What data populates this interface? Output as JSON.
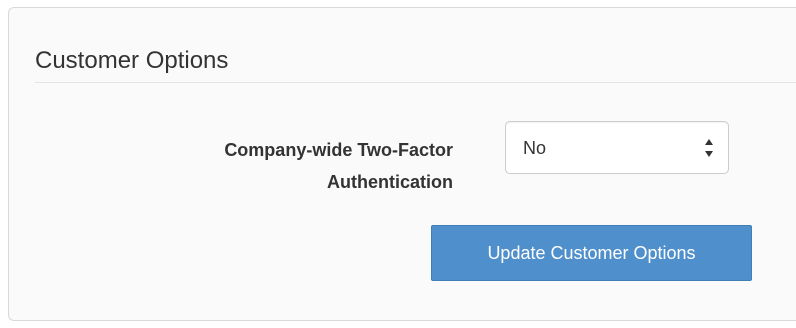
{
  "panel": {
    "title": "Customer Options"
  },
  "form": {
    "two_factor": {
      "label": "Company-wide Two-Factor Authentication",
      "selected_value": "No"
    },
    "submit_label": "Update Customer Options"
  },
  "icons": {
    "select_arrows": "sort-arrows-icon"
  },
  "colors": {
    "button_bg": "#4f8fcb",
    "button_border": "#3f7fb8",
    "panel_bg": "#fafafa",
    "panel_border": "#d9d9d9"
  }
}
